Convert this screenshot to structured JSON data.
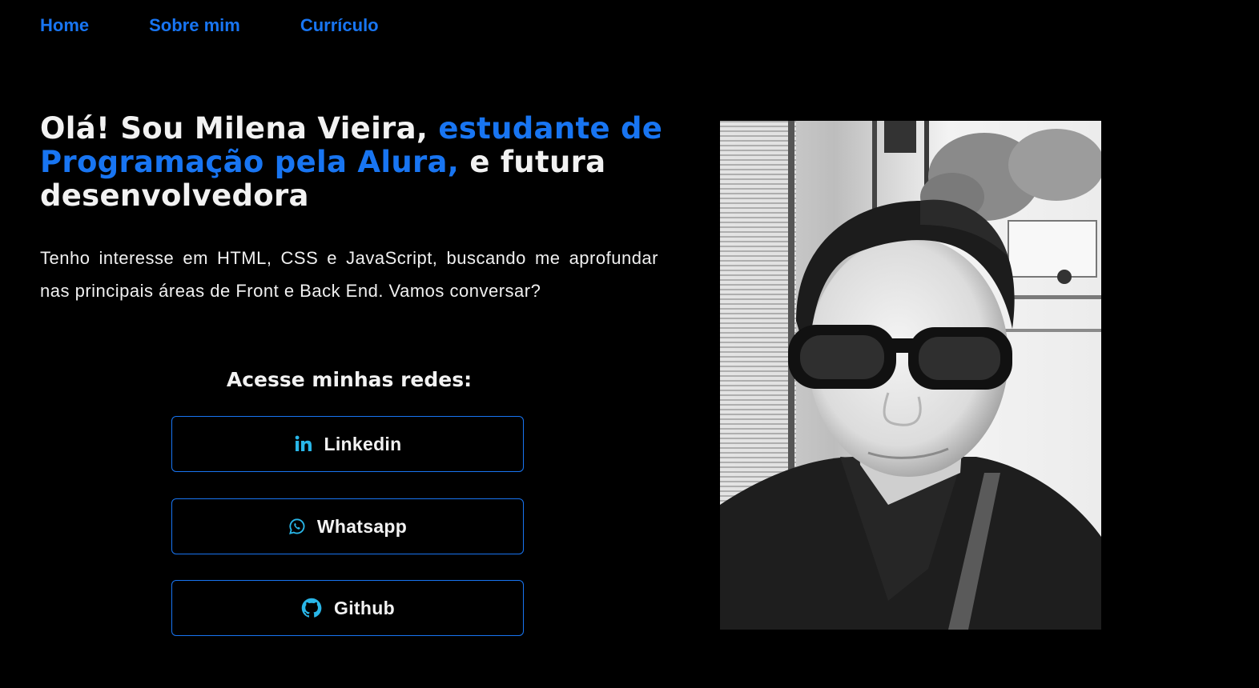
{
  "nav": {
    "items": [
      {
        "label": "Home"
      },
      {
        "label": "Sobre mim"
      },
      {
        "label": "Currículo"
      }
    ]
  },
  "hero": {
    "headline_part1": "Olá! Sou Milena Vieira, ",
    "headline_accent": "estudante de Programação pela Alura,",
    "headline_part2": " e futura desenvolvedora",
    "intro": "Tenho interesse em HTML, CSS e JavaScript, buscando me aprofundar nas principais áreas de Front e Back End. Vamos conversar?"
  },
  "social": {
    "title": "Acesse minhas redes:",
    "links": [
      {
        "label": "Linkedin",
        "icon": "linkedin-icon"
      },
      {
        "label": "Whatsapp",
        "icon": "whatsapp-icon"
      },
      {
        "label": "Github",
        "icon": "github-icon"
      }
    ]
  },
  "colors": {
    "background": "#000000",
    "accent": "#1875f2",
    "icon_cyan": "#29b6e8",
    "text": "#f2f2f2"
  }
}
